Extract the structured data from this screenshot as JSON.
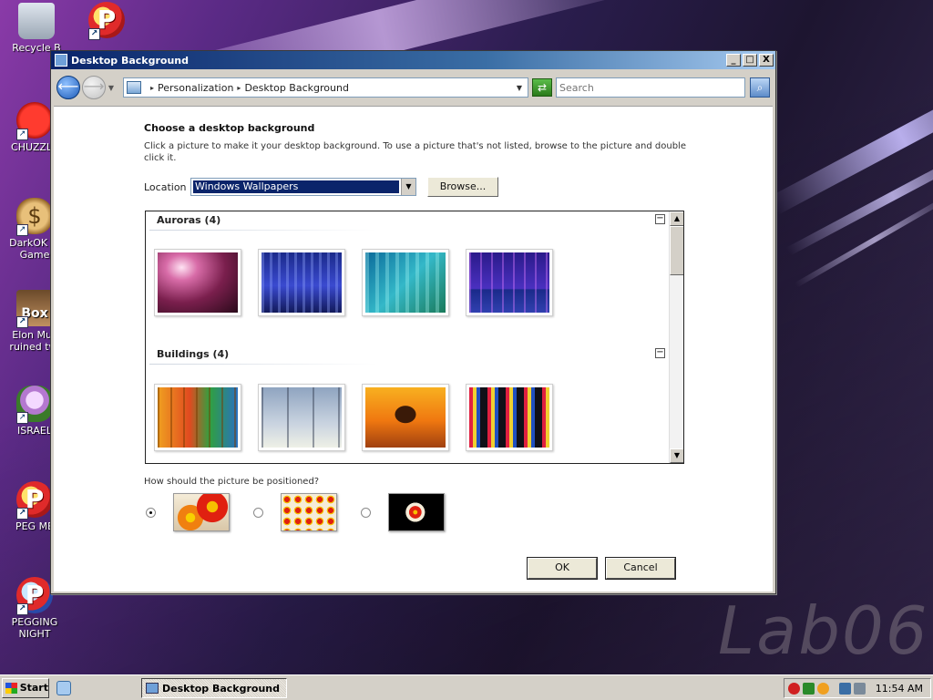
{
  "desktop": {
    "watermark": "Lab06",
    "icons": [
      {
        "label": "Recycle B",
        "icon": "recycle-bin-icon"
      },
      {
        "label": "CHUZZLE",
        "icon": "chuzzle-icon"
      },
      {
        "label": "DarkOK Vi Game",
        "icon": "money-bag-icon"
      },
      {
        "label": "Elon Mus ruined twi",
        "icon": "box-game-icon"
      },
      {
        "label": "ISRAEL",
        "icon": "flower-icon"
      },
      {
        "label": "PEG ME",
        "icon": "peggle-icon"
      },
      {
        "label": "PEGGING NIGHT",
        "icon": "peggle-nights-icon"
      }
    ]
  },
  "window": {
    "title": "Desktop Background",
    "controls": {
      "minimize": "_",
      "maximize": "□",
      "close": "X"
    },
    "breadcrumbs": [
      "Personalization",
      "Desktop Background"
    ],
    "search": {
      "placeholder": "Search",
      "value": ""
    },
    "heading": "Choose a desktop background",
    "description": "Click a picture to make it your desktop background. To use a picture that's not listed, browse to the picture and double click it.",
    "location_label": "Location",
    "location_value": "Windows Wallpapers",
    "browse_label": "Browse...",
    "groups": [
      {
        "label": "Auroras (4)",
        "thumbs": [
          "aurora-pink",
          "aurora-blue",
          "aurora-teal",
          "aurora-purple"
        ]
      },
      {
        "label": "Buildings (4)",
        "thumbs": [
          "glass-building",
          "sky-windows",
          "taj-mahal",
          "city-night"
        ]
      }
    ],
    "position_question": "How should the picture be positioned?",
    "position_options": [
      "fit-to-screen",
      "tile",
      "center"
    ],
    "position_selected": "fit-to-screen",
    "ok_label": "OK",
    "cancel_label": "Cancel"
  },
  "taskbar": {
    "start_label": "Start",
    "task_label": "Desktop Background",
    "clock": "11:54 AM"
  }
}
